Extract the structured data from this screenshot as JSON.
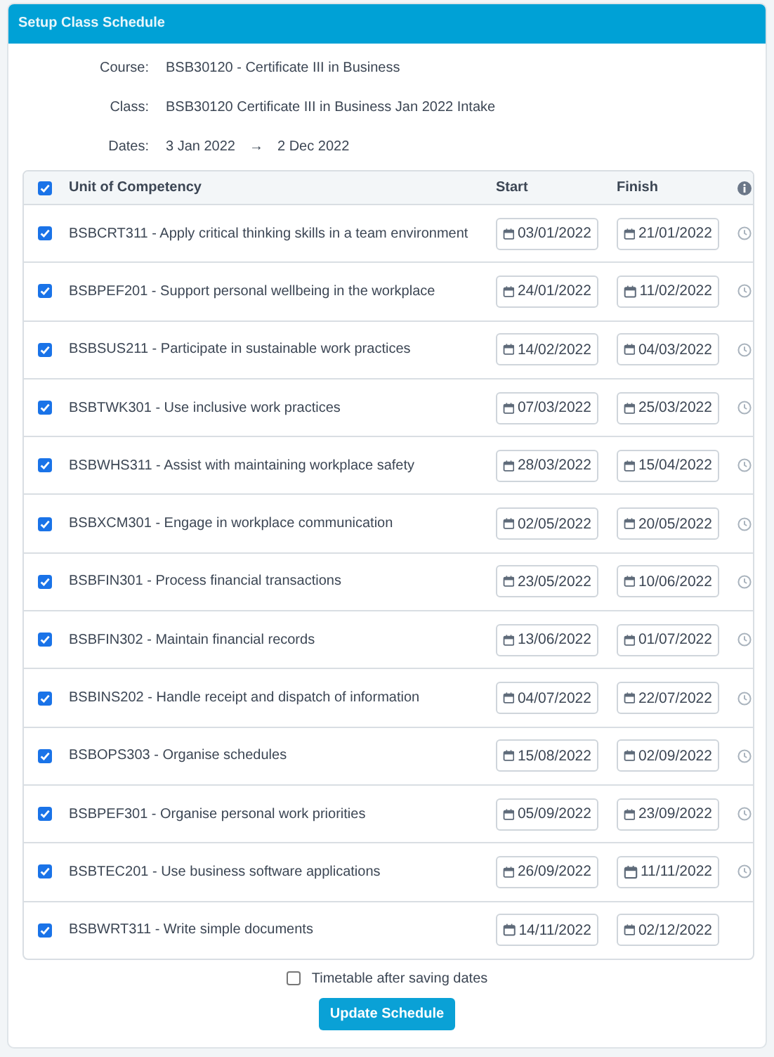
{
  "panel": {
    "title": "Setup Class Schedule"
  },
  "details": [
    {
      "label": "Course:",
      "value": "BSB30120 - Certificate III in Business"
    },
    {
      "label": "Class:",
      "value": "BSB30120 Certificate III in Business Jan 2022 Intake"
    },
    {
      "label": "Dates:",
      "start": "3 Jan 2022",
      "arrow": "→",
      "end": "2 Dec 2022"
    }
  ],
  "table": {
    "select_all_checked": true,
    "columns": [
      "Unit of Competency",
      "Start",
      "Finish"
    ],
    "rows": [
      {
        "checked": true,
        "unit": "BSBCRT311 - Apply critical thinking skills in a team environment",
        "start": "03/01/2022",
        "finish": "21/01/2022",
        "clock": true
      },
      {
        "checked": true,
        "unit": "BSBPEF201 - Support personal wellbeing in the workplace",
        "start": "24/01/2022",
        "finish": "11/02/2022",
        "clock": true
      },
      {
        "checked": true,
        "unit": "BSBSUS211 - Participate in sustainable work practices",
        "start": "14/02/2022",
        "finish": "04/03/2022",
        "clock": true
      },
      {
        "checked": true,
        "unit": "BSBTWK301 - Use inclusive work practices",
        "start": "07/03/2022",
        "finish": "25/03/2022",
        "clock": true
      },
      {
        "checked": true,
        "unit": "BSBWHS311 - Assist with maintaining workplace safety",
        "start": "28/03/2022",
        "finish": "15/04/2022",
        "clock": true
      },
      {
        "checked": true,
        "unit": "BSBXCM301 - Engage in workplace communication",
        "start": "02/05/2022",
        "finish": "20/05/2022",
        "clock": true
      },
      {
        "checked": true,
        "unit": "BSBFIN301 - Process financial transactions",
        "start": "23/05/2022",
        "finish": "10/06/2022",
        "clock": true
      },
      {
        "checked": true,
        "unit": "BSBFIN302 - Maintain financial records",
        "start": "13/06/2022",
        "finish": "01/07/2022",
        "clock": true
      },
      {
        "checked": true,
        "unit": "BSBINS202 - Handle receipt and dispatch of information",
        "start": "04/07/2022",
        "finish": "22/07/2022",
        "clock": true
      },
      {
        "checked": true,
        "unit": "BSBOPS303 - Organise schedules",
        "start": "15/08/2022",
        "finish": "02/09/2022",
        "clock": true
      },
      {
        "checked": true,
        "unit": "BSBPEF301 - Organise personal work priorities",
        "start": "05/09/2022",
        "finish": "23/09/2022",
        "clock": true
      },
      {
        "checked": true,
        "unit": "BSBTEC201 - Use business software applications",
        "start": "26/09/2022",
        "finish": "11/11/2022",
        "clock": true
      },
      {
        "checked": true,
        "unit": "BSBWRT311 - Write simple documents",
        "start": "14/11/2022",
        "finish": "02/12/2022",
        "clock": false
      }
    ]
  },
  "timetable_option": {
    "label": "Timetable after saving dates",
    "checked": false
  },
  "button": "Update Schedule"
}
